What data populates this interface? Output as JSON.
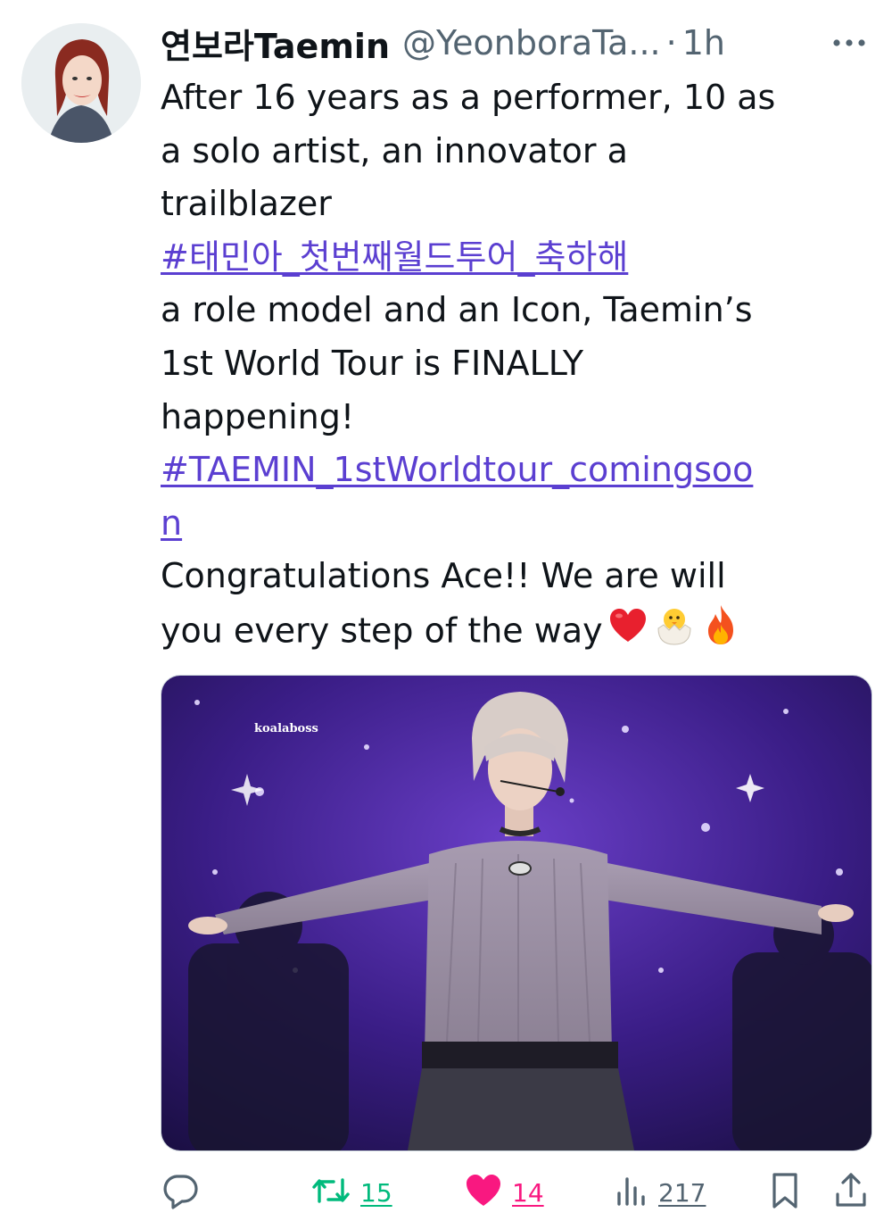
{
  "tweet": {
    "display_name": "연보라Taemin",
    "handle": "@YeonboraTa...",
    "separator": "·",
    "time": "1h",
    "text_lines": [
      {
        "text": "After 16 years as a performer, 10 as",
        "link": false
      },
      {
        "text": "a solo artist, an innovator a",
        "link": false
      },
      {
        "text": "trailblazer",
        "link": false
      },
      {
        "text": "#태민아_첫번째월드투어_축하해",
        "link": true
      },
      {
        "text": "a role model and an Icon, Taemin’s",
        "link": false
      },
      {
        "text": "1st World Tour is FINALLY",
        "link": false
      },
      {
        "text": "happening!",
        "link": false
      },
      {
        "text": "#TAEMIN_1stWorldtour_comingsoo",
        "link": true
      },
      {
        "text": "n",
        "link": true
      },
      {
        "text": "Congratulations Ace!! We are will",
        "link": false
      },
      {
        "text": "you every step of the way",
        "link": false
      }
    ],
    "trailing_emojis": [
      "red-heart-emoji",
      "hatching-chick-emoji",
      "fire-emoji"
    ]
  },
  "media": {
    "watermark": "koalaboss"
  },
  "actions": {
    "retweet_count": "15",
    "like_count": "14",
    "views_count": "217"
  },
  "colors": {
    "link": "#5b3fd1",
    "retweet": "#00ba7c",
    "like": "#f91880",
    "icon_gray": "#536471"
  }
}
